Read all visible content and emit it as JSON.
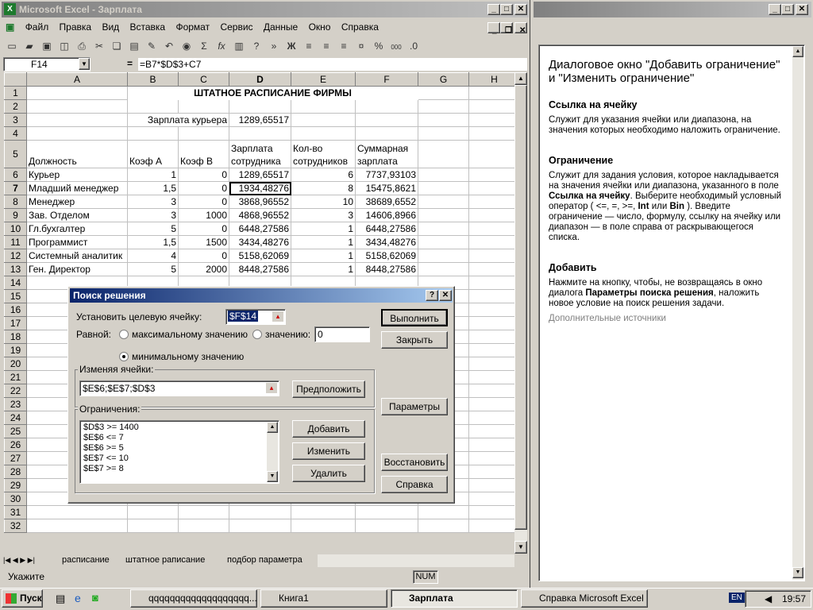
{
  "excel": {
    "title": "Microsoft Excel - Зарплата",
    "menu": [
      "Файл",
      "Правка",
      "Вид",
      "Вставка",
      "Формат",
      "Сервис",
      "Данные",
      "Окно",
      "Справка"
    ],
    "toolbar_icons": [
      "new-icon",
      "open-icon",
      "save-icon",
      "permission-icon",
      "print-icon",
      "cut-icon",
      "copy-icon",
      "paste-icon",
      "format-painter-icon",
      "undo-icon",
      "hyperlink-icon",
      "autosum-icon",
      "function-icon",
      "chart-icon",
      "help-icon",
      "more-icon"
    ],
    "toolbar_glyphs": {
      "autosum": "Σ",
      "function": "fx",
      "bold": "Ж",
      "percent": "%",
      "thousands": "000"
    },
    "name_box": "F14",
    "formula_eq": "=",
    "formula": "=B7*$D$3+C7",
    "columns": [
      "A",
      "B",
      "C",
      "D",
      "E",
      "F",
      "G",
      "H"
    ],
    "rows": [
      {
        "n": "1",
        "cells": [
          "",
          "",
          "",
          "",
          "",
          "",
          "",
          ""
        ],
        "title": "ШТАТНОЕ РАСПИСАНИЕ ФИРМЫ"
      },
      {
        "n": "2",
        "cells": [
          "",
          "",
          "",
          "",
          "",
          "",
          "",
          ""
        ]
      },
      {
        "n": "3",
        "cells": [
          "",
          "Зарплата курьера",
          "",
          "1289,65517",
          "",
          "",
          "",
          ""
        ]
      },
      {
        "n": "4",
        "cells": [
          "",
          "",
          "",
          "",
          "",
          "",
          "",
          ""
        ]
      },
      {
        "n": "5",
        "cells": [
          "Должность",
          "Коэф А",
          "Коэф В",
          "Зарплата сотрудника",
          "Кол-во сотрудников",
          "Суммарная зарплата",
          "",
          ""
        ]
      },
      {
        "n": "6",
        "cells": [
          "Курьер",
          "1",
          "0",
          "1289,65517",
          "6",
          "7737,93103",
          "",
          ""
        ]
      },
      {
        "n": "7",
        "cells": [
          "Младший менеджер",
          "1,5",
          "0",
          "1934,48276",
          "8",
          "15475,8621",
          "",
          ""
        ]
      },
      {
        "n": "8",
        "cells": [
          "Менеджер",
          "3",
          "0",
          "3868,96552",
          "10",
          "38689,6552",
          "",
          ""
        ]
      },
      {
        "n": "9",
        "cells": [
          "Зав. Отделом",
          "3",
          "1000",
          "4868,96552",
          "3",
          "14606,8966",
          "",
          ""
        ]
      },
      {
        "n": "10",
        "cells": [
          "Гл.бухгалтер",
          "5",
          "0",
          "6448,27586",
          "1",
          "6448,27586",
          "",
          ""
        ]
      },
      {
        "n": "11",
        "cells": [
          "Программист",
          "1,5",
          "1500",
          "3434,48276",
          "1",
          "3434,48276",
          "",
          ""
        ]
      },
      {
        "n": "12",
        "cells": [
          "Системный аналитик",
          "4",
          "0",
          "5158,62069",
          "1",
          "5158,62069",
          "",
          ""
        ]
      },
      {
        "n": "13",
        "cells": [
          "Ген. Директор",
          "5",
          "2000",
          "8448,27586",
          "1",
          "8448,27586",
          "",
          ""
        ]
      }
    ],
    "empty_rows": [
      "14",
      "15",
      "16",
      "17",
      "18",
      "19",
      "20",
      "21",
      "22",
      "23",
      "24",
      "25",
      "26",
      "27",
      "28",
      "29",
      "30",
      "31",
      "32"
    ],
    "sheet_tabs": [
      "расписание",
      "штатное раписание",
      "подбор параметра"
    ],
    "status_left": "Укажите",
    "status_num": "NUM"
  },
  "solver": {
    "title": "Поиск решения",
    "help_q": "?",
    "close_x": "✕",
    "target_label": "Установить целевую ячейку:",
    "target_value": "$F$14",
    "equal_label": "Равной:",
    "opt_max": "максимальному значению",
    "opt_value": "значению:",
    "value_field": "0",
    "opt_min": "минимальному значению",
    "changing_label": "Изменяя ячейки:",
    "changing_value": "$E$6;$E$7;$D$3",
    "guess_btn": "Предположить",
    "constraints_label": "Ограничения:",
    "constraints": [
      "$D$3 >= 1400",
      "$E$6 <= 7",
      "$E$6 >= 5",
      "$E$7 <= 10",
      "$E$7 >= 8"
    ],
    "btn_solve": "Выполнить",
    "btn_close": "Закрыть",
    "btn_options": "Параметры",
    "btn_add": "Добавить",
    "btn_change": "Изменить",
    "btn_delete": "Удалить",
    "btn_reset": "Восстановить",
    "btn_help": "Справка"
  },
  "help": {
    "heading": "Диалоговое окно \"Добавить ограничение\" и \"Изменить ограничение\"",
    "s1_title": "Ссылка на ячейку",
    "s1_text": "Служит для указания ячейки или диапазона, на значения которых необходимо наложить ограничение.",
    "s2_title": "Ограничение",
    "s2_text_a": "Служит для задания условия, которое накладывается на значения ячейки или диапазона, указанного в поле ",
    "s2_text_b": "Ссылка на ячейку",
    "s2_text_c": ". Выберите необходимый условный оператор ( <=, =, >=, ",
    "s2_text_d": "Int",
    "s2_text_e": " или ",
    "s2_text_f": "Bin",
    "s2_text_g": " ). Введите ограничение — число, формулу, ссылку на ячейку или диапазон — в поле справа от раскрывающегося списка.",
    "s3_title": "Добавить",
    "s3_text_a": "Нажмите на кнопку, чтобы, не возвращаясь в окно диалога ",
    "s3_text_b": "Параметры поиска решения",
    "s3_text_c": ", наложить новое условие на поиск решения задачи.",
    "more": "Дополнительные источники"
  },
  "taskbar": {
    "start": "Пуск",
    "items": [
      "qqqqqqqqqqqqqqqqqqq...",
      "Книга1",
      "Зарплата",
      "Справка Microsoft Excel"
    ],
    "lang": "EN",
    "clock": "19:57"
  }
}
